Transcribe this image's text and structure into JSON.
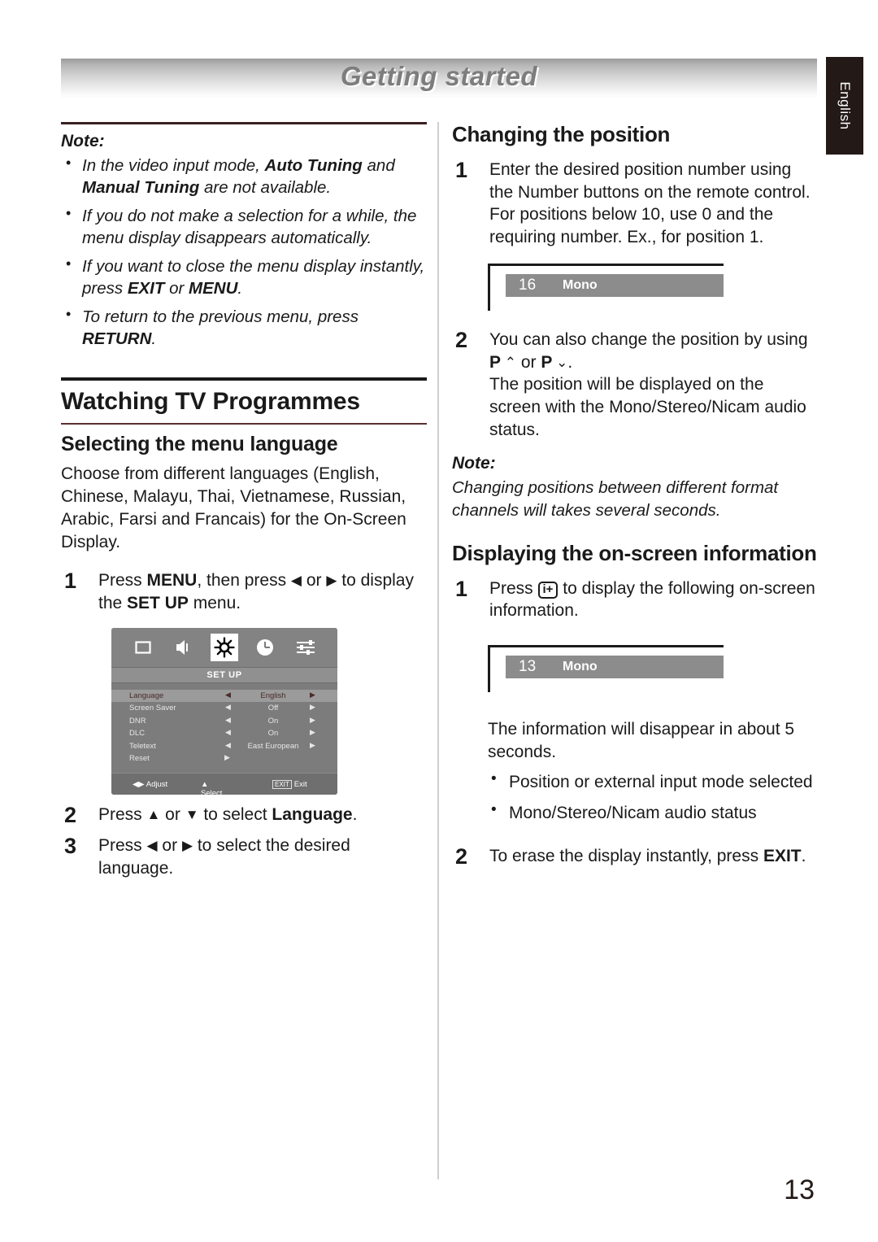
{
  "banner": {
    "title": "Getting started"
  },
  "language_tab": {
    "label": "English"
  },
  "page_number": "13",
  "left_column": {
    "note": {
      "label": "Note:",
      "items": [
        {
          "parts": [
            {
              "t": "In the video input mode, ",
              "s": "i"
            },
            {
              "t": "Auto Tuning",
              "s": "bi"
            },
            {
              "t": " and ",
              "s": "i"
            },
            {
              "t": "Manual Tuning",
              "s": "bi"
            },
            {
              "t": " are not available.",
              "s": "i"
            }
          ]
        },
        {
          "parts": [
            {
              "t": "If you do not make a selection for a while, the menu display disappears automatically.",
              "s": "i"
            }
          ]
        },
        {
          "parts": [
            {
              "t": "If you want to close the menu display instantly, press ",
              "s": "i"
            },
            {
              "t": "EXIT",
              "s": "bi"
            },
            {
              "t": " or ",
              "s": "i"
            },
            {
              "t": "MENU",
              "s": "bi"
            },
            {
              "t": ".",
              "s": "i"
            }
          ]
        },
        {
          "parts": [
            {
              "t": "To return to the previous menu, press ",
              "s": "i"
            },
            {
              "t": "RETURN",
              "s": "bi"
            },
            {
              "t": ".",
              "s": "i"
            }
          ]
        }
      ]
    },
    "section_title": "Watching TV Programmes",
    "sub_title": "Selecting the menu language",
    "intro": "Choose from different languages (English, Chinese, Malayu, Thai, Vietnamese, Russian, Arabic, Farsi and Francais) for the On-Screen Display.",
    "steps": [
      {
        "num": "1",
        "parts": [
          {
            "t": "Press ",
            "s": "n"
          },
          {
            "t": "MENU",
            "s": "b"
          },
          {
            "t": ", then press ",
            "s": "n"
          },
          {
            "t": "◀",
            "s": "arrow"
          },
          {
            "t": " or ",
            "s": "n"
          },
          {
            "t": "▶",
            "s": "arrow"
          },
          {
            "t": " to display the ",
            "s": "n"
          },
          {
            "t": "SET UP",
            "s": "b"
          },
          {
            "t": " menu.",
            "s": "n"
          }
        ]
      },
      {
        "num": "2",
        "parts": [
          {
            "t": "Press ",
            "s": "n"
          },
          {
            "t": "▲",
            "s": "arrow"
          },
          {
            "t": " or ",
            "s": "n"
          },
          {
            "t": "▼",
            "s": "arrow"
          },
          {
            "t": " to select ",
            "s": "n"
          },
          {
            "t": "Language",
            "s": "b"
          },
          {
            "t": ".",
            "s": "n"
          }
        ]
      },
      {
        "num": "3",
        "parts": [
          {
            "t": "Press ",
            "s": "n"
          },
          {
            "t": "◀",
            "s": "arrow"
          },
          {
            "t": " or ",
            "s": "n"
          },
          {
            "t": "▶",
            "s": "arrow"
          },
          {
            "t": " to select the desired language.",
            "s": "n"
          }
        ]
      }
    ],
    "tv_menu": {
      "icons": [
        "picture-icon",
        "sound-icon",
        "setup-gear-icon",
        "timer-clock-icon",
        "feature-sliders-icon"
      ],
      "active_icon_index": 2,
      "header_label": "SET UP",
      "rows": [
        {
          "label": "Language",
          "value": "English",
          "left_arrow": "◀",
          "right_arrow": "▶",
          "selected": true
        },
        {
          "label": "Screen Saver",
          "value": "Off",
          "left_arrow": "◀",
          "right_arrow": "▶",
          "selected": false
        },
        {
          "label": "DNR",
          "value": "On",
          "left_arrow": "◀",
          "right_arrow": "▶",
          "selected": false
        },
        {
          "label": "DLC",
          "value": "On",
          "left_arrow": "◀",
          "right_arrow": "▶",
          "selected": false
        },
        {
          "label": "Teletext",
          "value": "East European",
          "left_arrow": "◀",
          "right_arrow": "▶",
          "selected": false
        },
        {
          "label": "Reset",
          "value": "",
          "left_arrow": "",
          "right_arrow": "▶",
          "selected": false,
          "only_right": true
        }
      ],
      "footer": {
        "adjust": "Adjust",
        "select": "Select",
        "exit_key": "EXIT",
        "exit": "Exit"
      }
    }
  },
  "right_column": {
    "changing_position": {
      "title": "Changing the position",
      "steps": [
        {
          "num": "1",
          "text": "Enter the desired position number using the Number buttons on the remote control. For positions below 10, use 0 and the requiring number.  Ex., for position 1."
        },
        {
          "num": "2",
          "parts": [
            {
              "t": "You can also change the position by using ",
              "s": "n"
            },
            {
              "t": "P",
              "s": "b"
            },
            {
              "t": " ⌃",
              "s": "arrow"
            },
            {
              "t": " or ",
              "s": "n"
            },
            {
              "t": "P",
              "s": "b"
            },
            {
              "t": " ⌄",
              "s": "arrow"
            },
            {
              "t": ".",
              "s": "n"
            },
            {
              "t": "\n",
              "s": "br"
            },
            {
              "t": "The position will be displayed on the screen with the Mono/Stereo/Nicam audio status.",
              "s": "n"
            }
          ]
        }
      ],
      "osd_figure": {
        "position": "16",
        "audio": "Mono"
      },
      "note": {
        "label": "Note:",
        "text": "Changing positions between different format channels will takes several seconds."
      }
    },
    "on_screen_info": {
      "title": "Displaying the on-screen information",
      "step1": {
        "num": "1",
        "before": "Press ",
        "key_icon": "i+",
        "after": " to display the following on-screen information."
      },
      "osd_figure": {
        "position": "13",
        "audio": "Mono"
      },
      "disappear_text": "The information will disappear in about 5 seconds.",
      "bullets": [
        "Position or external input mode selected",
        "Mono/Stereo/Nicam audio status"
      ],
      "step2": {
        "num": "2",
        "parts": [
          {
            "t": "To erase the display instantly, press ",
            "s": "n"
          },
          {
            "t": "EXIT",
            "s": "b"
          },
          {
            "t": ".",
            "s": "n"
          }
        ]
      }
    }
  }
}
